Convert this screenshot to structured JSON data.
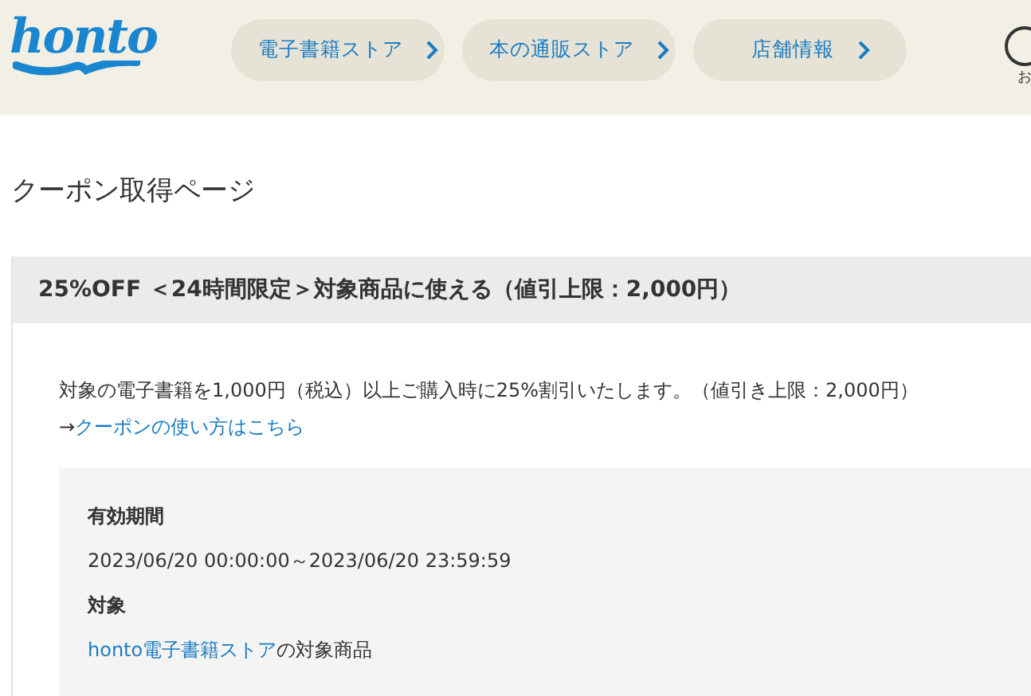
{
  "header": {
    "logo": "honto",
    "nav": [
      {
        "label": "電子書籍ストア"
      },
      {
        "label": "本の通販ストア"
      },
      {
        "label": "店舗情報"
      }
    ],
    "account_label": "お"
  },
  "page_title": "クーポン取得ページ",
  "coupon": {
    "title": "25%OFF ＜24時間限定＞対象商品に使える（値引上限：2,000円）",
    "description": "対象の電子書籍を1,000円（税込）以上ご購入時に25%割引いたします。（値引き上限：2,000円）",
    "help": {
      "prefix": "→",
      "link": "クーポンの使い方はこちら"
    },
    "details": [
      {
        "label": "有効期間",
        "value": "2023/06/20 00:00:00～2023/06/20 23:59:59"
      },
      {
        "label": "対象",
        "value_link": "honto電子書籍ストア",
        "value": "の対象商品"
      }
    ]
  }
}
